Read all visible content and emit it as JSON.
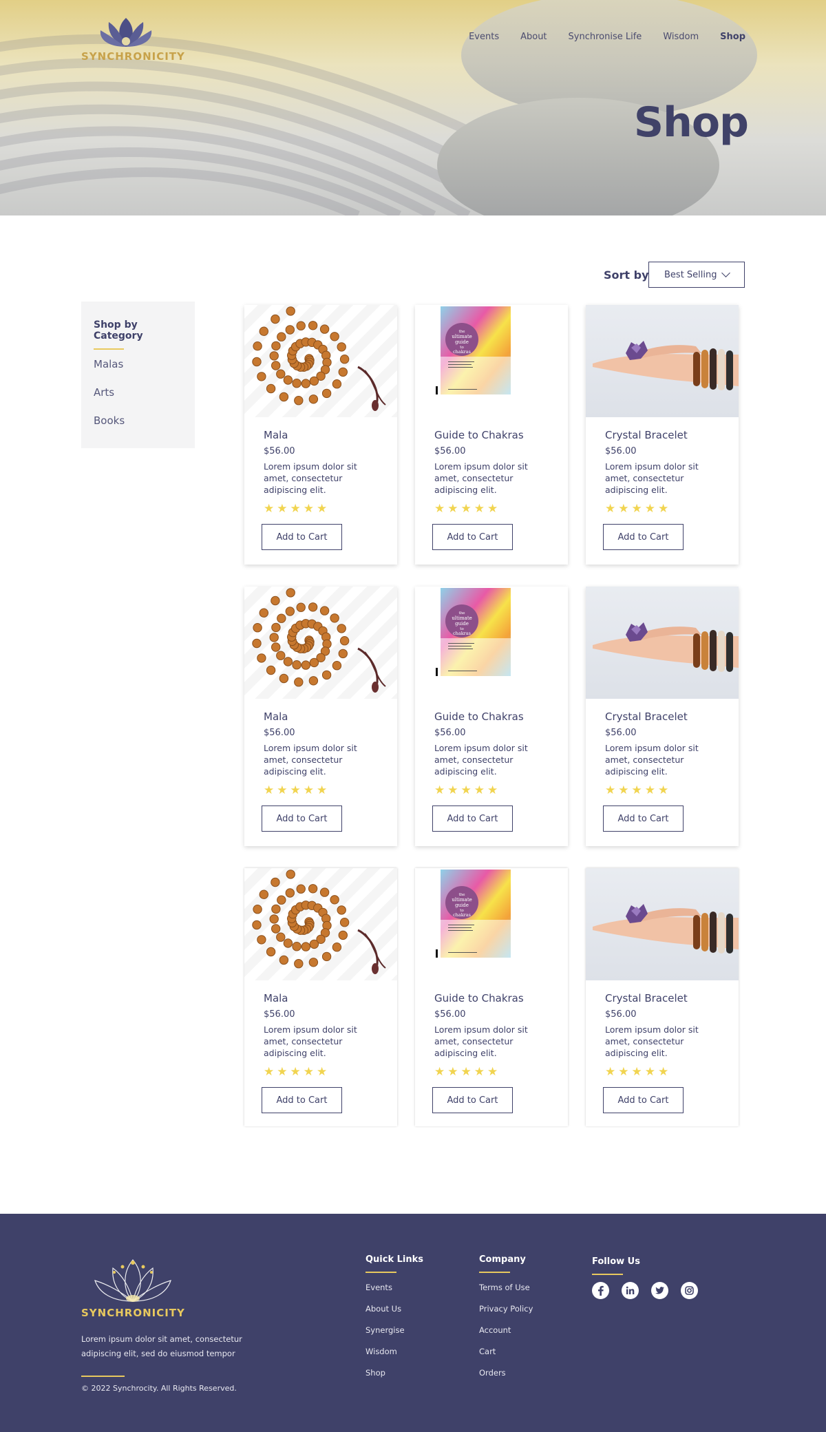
{
  "brand": {
    "name": "SYNCHRONICITY",
    "accent": "#e8c95e",
    "primary": "#3f4169"
  },
  "nav": {
    "items": [
      "Events",
      "About",
      "Synchronise Life",
      "Wisdom",
      "Shop"
    ],
    "active": "Shop"
  },
  "hero": {
    "title": "Shop"
  },
  "sort": {
    "label": "Sort by",
    "selected": "Best Selling"
  },
  "sidebar": {
    "title": "Shop by Category",
    "categories": [
      "Malas",
      "Arts",
      "Books"
    ]
  },
  "products": [
    {
      "name": "Mala",
      "price": "$56.00",
      "desc": "Lorem ipsum dolor sit amet, consectetur adipiscing elit.",
      "rating": 5,
      "button": "Add to Cart",
      "image": "mala-beads"
    },
    {
      "name": "Guide to Chakras",
      "price": "$56.00",
      "desc": "Lorem ipsum dolor sit amet, consectetur adipiscing elit.",
      "rating": 5,
      "button": "Add to Cart",
      "image": "chakra-book"
    },
    {
      "name": "Crystal Bracelet",
      "price": "$56.00",
      "desc": "Lorem ipsum dolor sit amet, consectetur adipiscing elit.",
      "rating": 5,
      "button": "Add to Cart",
      "image": "crystal-bracelet"
    },
    {
      "name": "Mala",
      "price": "$56.00",
      "desc": "Lorem ipsum dolor sit amet, consectetur adipiscing elit.",
      "rating": 5,
      "button": "Add to Cart",
      "image": "mala-beads"
    },
    {
      "name": "Guide to Chakras",
      "price": "$56.00",
      "desc": "Lorem ipsum dolor sit amet, consectetur adipiscing elit.",
      "rating": 5,
      "button": "Add to Cart",
      "image": "chakra-book"
    },
    {
      "name": "Crystal Bracelet",
      "price": "$56.00",
      "desc": "Lorem ipsum dolor sit amet, consectetur adipiscing elit.",
      "rating": 5,
      "button": "Add to Cart",
      "image": "crystal-bracelet"
    },
    {
      "name": "Mala",
      "price": "$56.00",
      "desc": "Lorem ipsum dolor sit amet, consectetur adipiscing elit.",
      "rating": 5,
      "button": "Add to Cart",
      "image": "mala-beads"
    },
    {
      "name": "Guide to Chakras",
      "price": "$56.00",
      "desc": "Lorem ipsum dolor sit amet, consectetur adipiscing elit.",
      "rating": 5,
      "button": "Add to Cart",
      "image": "chakra-book"
    },
    {
      "name": "Crystal Bracelet",
      "price": "$56.00",
      "desc": "Lorem ipsum dolor sit amet, consectetur adipiscing elit.",
      "rating": 5,
      "button": "Add to Cart",
      "image": "crystal-bracelet"
    }
  ],
  "book_cover": {
    "line1": "the",
    "line2": "ultimate",
    "line3": "guide",
    "line4": "to",
    "line5": "chakras"
  },
  "footer": {
    "about": "Lorem ipsum dolor sit amet, consectetur adipiscing elit, sed do eiusmod tempor",
    "copyright": "© 2022 Synchrocity. All Rights Reserved.",
    "quick_links": {
      "title": "Quick Links",
      "items": [
        "Events",
        "About Us",
        "Synergise",
        "Wisdom",
        "Shop"
      ]
    },
    "company": {
      "title": "Company",
      "items": [
        "Terms of Use",
        "Privacy Policy",
        "Account",
        "Cart",
        "Orders"
      ]
    },
    "follow": {
      "title": "Follow Us",
      "icons": [
        "facebook-icon",
        "linkedin-icon",
        "twitter-icon",
        "instagram-icon"
      ]
    }
  }
}
